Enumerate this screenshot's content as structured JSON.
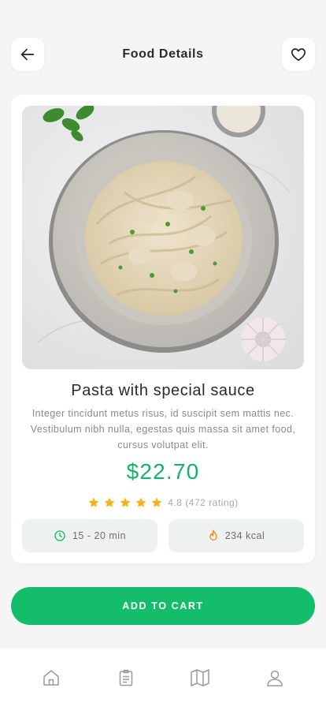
{
  "header": {
    "title": "Food Details",
    "back_icon": "arrow-left-icon",
    "favorite_icon": "heart-icon"
  },
  "food": {
    "name": "Pasta with special sauce",
    "description": "Integer tincidunt metus risus, id suscipit sem mattis nec. Vestibulum nibh nulla, egestas quis massa sit amet food, cursus volutpat elit.",
    "price": "$22.70",
    "rating": {
      "stars": 5,
      "text": "4.8 (472 rating)"
    },
    "time": "15 - 20 min",
    "calories": "234 kcal"
  },
  "actions": {
    "add_to_cart": "ADD TO CART"
  },
  "nav": {
    "items": [
      "home-icon",
      "clipboard-icon",
      "map-icon",
      "profile-icon"
    ]
  },
  "colors": {
    "accent": "#14bd69",
    "star": "#f5b31b",
    "calorie": "#f08a1c"
  }
}
